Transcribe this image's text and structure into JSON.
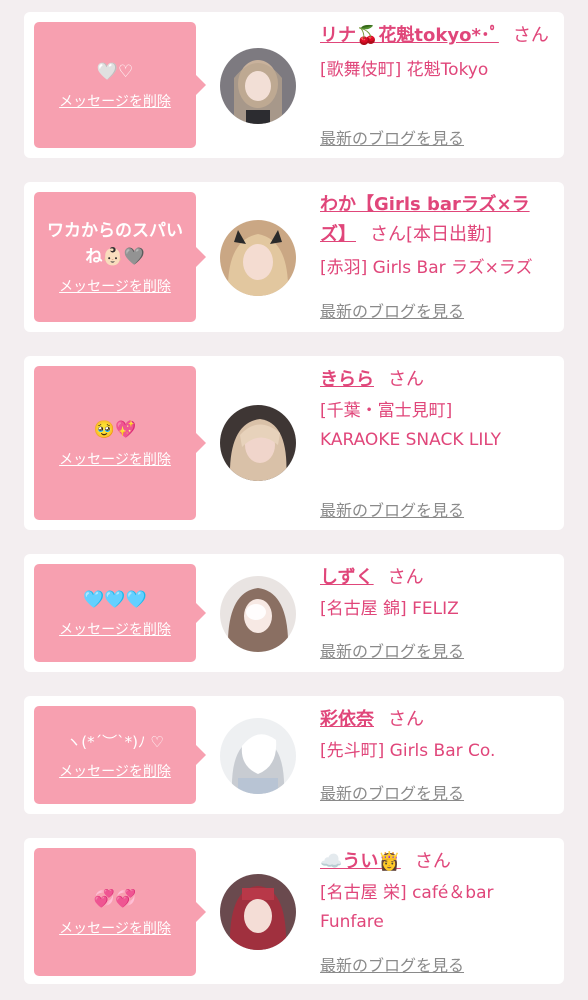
{
  "cards": [
    {
      "message": "🤍♡",
      "delete_label": "メッセージを削除",
      "name": "リナ🍒花魁tokyo*･ﾟ",
      "san": "さん",
      "status": "",
      "shop": "[歌舞伎町] 花魁Tokyo",
      "blog_label": "最新のブログを見る"
    },
    {
      "message": "ワカからのスパいね👶🏻🩶",
      "delete_label": "メッセージを削除",
      "name": "わか【Girls barラズ×ラズ】",
      "san": "さん",
      "status": "[本日出勤]",
      "shop": "[赤羽] Girls Bar ラズ×ラズ",
      "blog_label": "最新のブログを見る"
    },
    {
      "message": "🥹💖",
      "delete_label": "メッセージを削除",
      "name": "きらら",
      "san": "さん",
      "status": "",
      "shop": "[千葉・富士見町] KARAOKE SNACK LILY",
      "blog_label": "最新のブログを見る"
    },
    {
      "message": "🩵🩵🩵",
      "delete_label": "メッセージを削除",
      "name": "しずく",
      "san": "さん",
      "status": "",
      "shop": "[名古屋 錦] FELIZ",
      "blog_label": "最新のブログを見る"
    },
    {
      "message": "ヽ(*´︶`*)ﾉ ♡",
      "delete_label": "メッセージを削除",
      "name": "彩依奈",
      "san": "さん",
      "status": "",
      "shop": "[先斗町] Girls Bar Co.",
      "blog_label": "最新のブログを見る"
    },
    {
      "message": "💞💞",
      "delete_label": "メッセージを削除",
      "name": "☁️うい👸",
      "san": "さん",
      "status": "",
      "shop": "[名古屋 栄] café＆bar Funfare",
      "blog_label": "最新のブログを見る"
    }
  ],
  "colors": {
    "background": "#f3eef0",
    "card": "#ffffff",
    "bubble": "#f7a0b0",
    "accent": "#e0467a",
    "link_gray": "#8a8a8a"
  }
}
